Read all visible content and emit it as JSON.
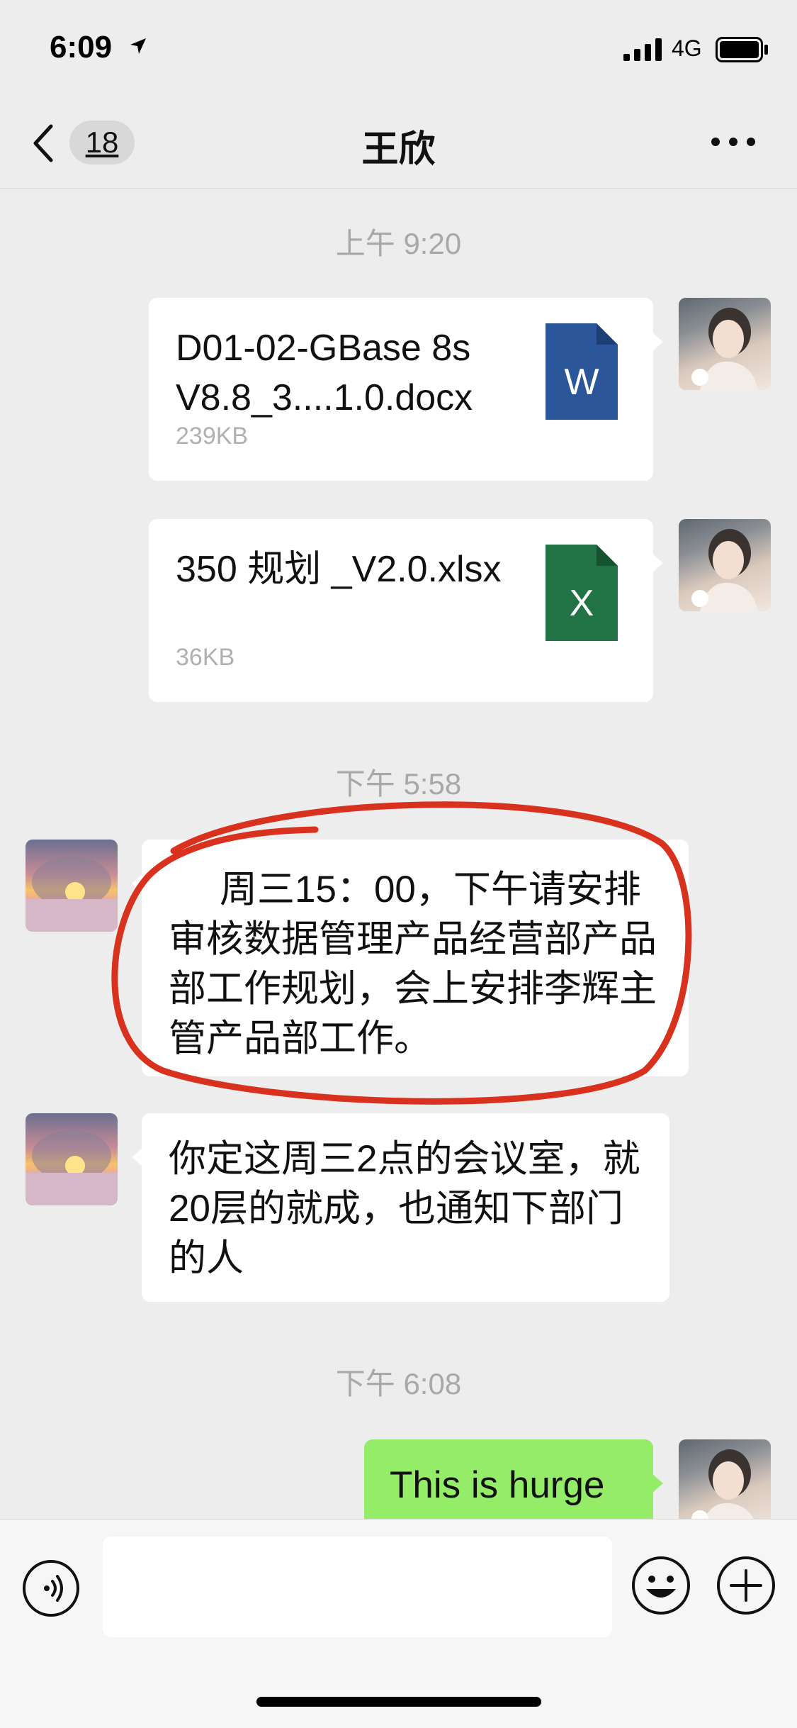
{
  "status_bar": {
    "time": "6:09",
    "network": "4G",
    "icons": [
      "location-arrow-icon",
      "signal-icon",
      "battery-icon"
    ]
  },
  "nav": {
    "back_count": "18",
    "title": "王欣",
    "icons": [
      "back-chevron-icon",
      "more-icon"
    ]
  },
  "messages": {
    "ts1": "上午 9:20",
    "file1": {
      "name": "D01-02-GBase 8s V8.8_3....1.0.docx",
      "size": "239KB",
      "icon_letter": "W",
      "icon": "word-file-icon"
    },
    "file2": {
      "name": "350 规划 _V2.0.xlsx",
      "size": "36KB",
      "icon_letter": "X",
      "icon": "excel-file-icon"
    },
    "ts2": "下午 5:58",
    "msg1": "周三15：00，下午请安排审核数据管理产品经营部产品部工作规划，会上安排李辉主管产品部工作。",
    "msg2": "你定这周三2点的会议室，就20层的就成，也通知下部门的人",
    "ts3": "下午 6:08",
    "msg3": "This is hurge"
  },
  "colors": {
    "background": "#ededed",
    "bubble_green": "#95ec69",
    "word_blue": "#2b579a",
    "excel_green": "#217346",
    "annotation_red": "#d8321f"
  },
  "input_bar": {
    "placeholder": "",
    "icons": [
      "voice-icon",
      "emoji-icon",
      "plus-icon"
    ]
  }
}
